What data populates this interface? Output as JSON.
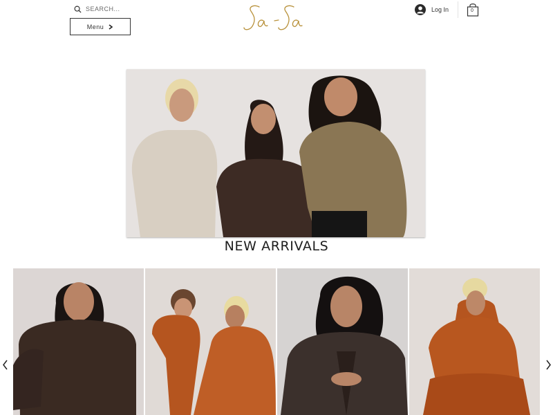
{
  "header": {
    "search": {
      "placeholder": "SEARCH...",
      "icon": "search-icon"
    },
    "menu": {
      "label": "Menu",
      "icon": "chevron-right-icon"
    },
    "logo_text": "Sa - Sa",
    "login": {
      "label": "Log In",
      "icon": "user-avatar-icon"
    },
    "cart": {
      "count": "0",
      "icon": "shopping-bag-icon"
    }
  },
  "hero": {
    "image": "three-women-smiling-photo"
  },
  "section": {
    "title": "NEW ARRIVALS"
  },
  "gallery": {
    "items": [
      {
        "image": "woman-brown-sweatshirt-photo"
      },
      {
        "image": "woman-and-toddler-rust-hoodies-photo"
      },
      {
        "image": "woman-dark-coat-photo"
      },
      {
        "image": "woman-rust-hoodie-crouching-photo"
      }
    ],
    "prev_icon": "chevron-left-icon",
    "next_icon": "chevron-right-icon"
  },
  "colors": {
    "logo_gold": "#b8913a",
    "text_dark": "#1d1d1d",
    "rust": "#b5551f",
    "brown": "#3a2a22",
    "olive": "#8a7654",
    "beige": "#d8cfc2"
  }
}
